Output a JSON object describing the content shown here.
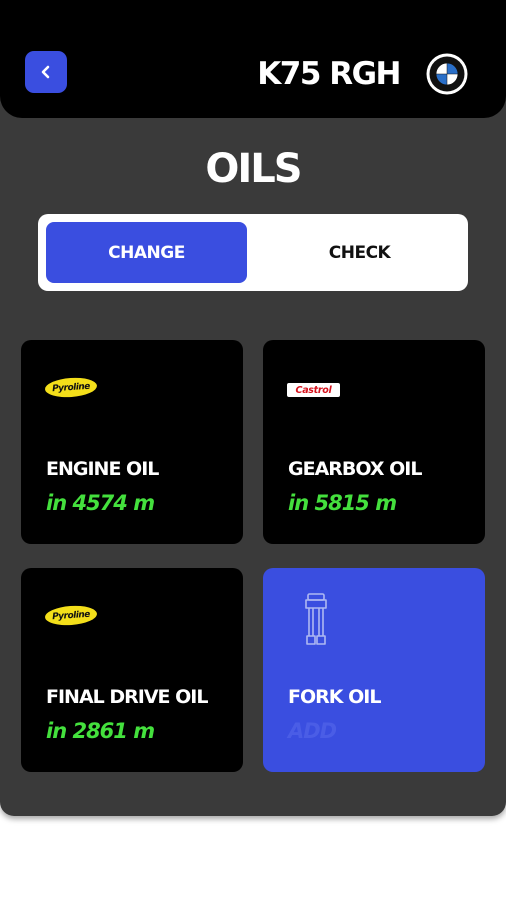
{
  "header": {
    "plate": "K75 RGH",
    "brand_icon": "bmw-logo"
  },
  "page": {
    "title": "OILS"
  },
  "segment": {
    "options": [
      "CHANGE",
      "CHECK"
    ],
    "selected": "CHANGE"
  },
  "cards": [
    {
      "logo": "Pyroline",
      "name": "ENGINE OIL",
      "due": "in 4574 m"
    },
    {
      "logo": "Castrol",
      "name": "GEARBOX OIL",
      "due": "in 5815 m"
    },
    {
      "logo": "Pyroline",
      "name": "FINAL DRIVE OIL",
      "due": "in 2861 m"
    },
    {
      "icon": "fork-icon",
      "name": "FORK OIL",
      "due": "ADD"
    }
  ],
  "colors": {
    "accent": "#3a4ee0",
    "due_text": "#44e03d",
    "panel": "#3a3a3a",
    "header": "#000000"
  }
}
